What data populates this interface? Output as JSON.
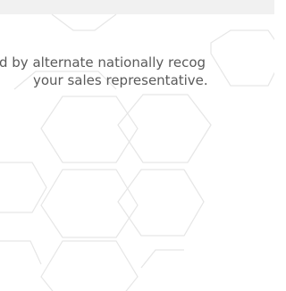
{
  "notice": {
    "line1": "d by alternate nationally recog",
    "line2": "your sales representative."
  }
}
